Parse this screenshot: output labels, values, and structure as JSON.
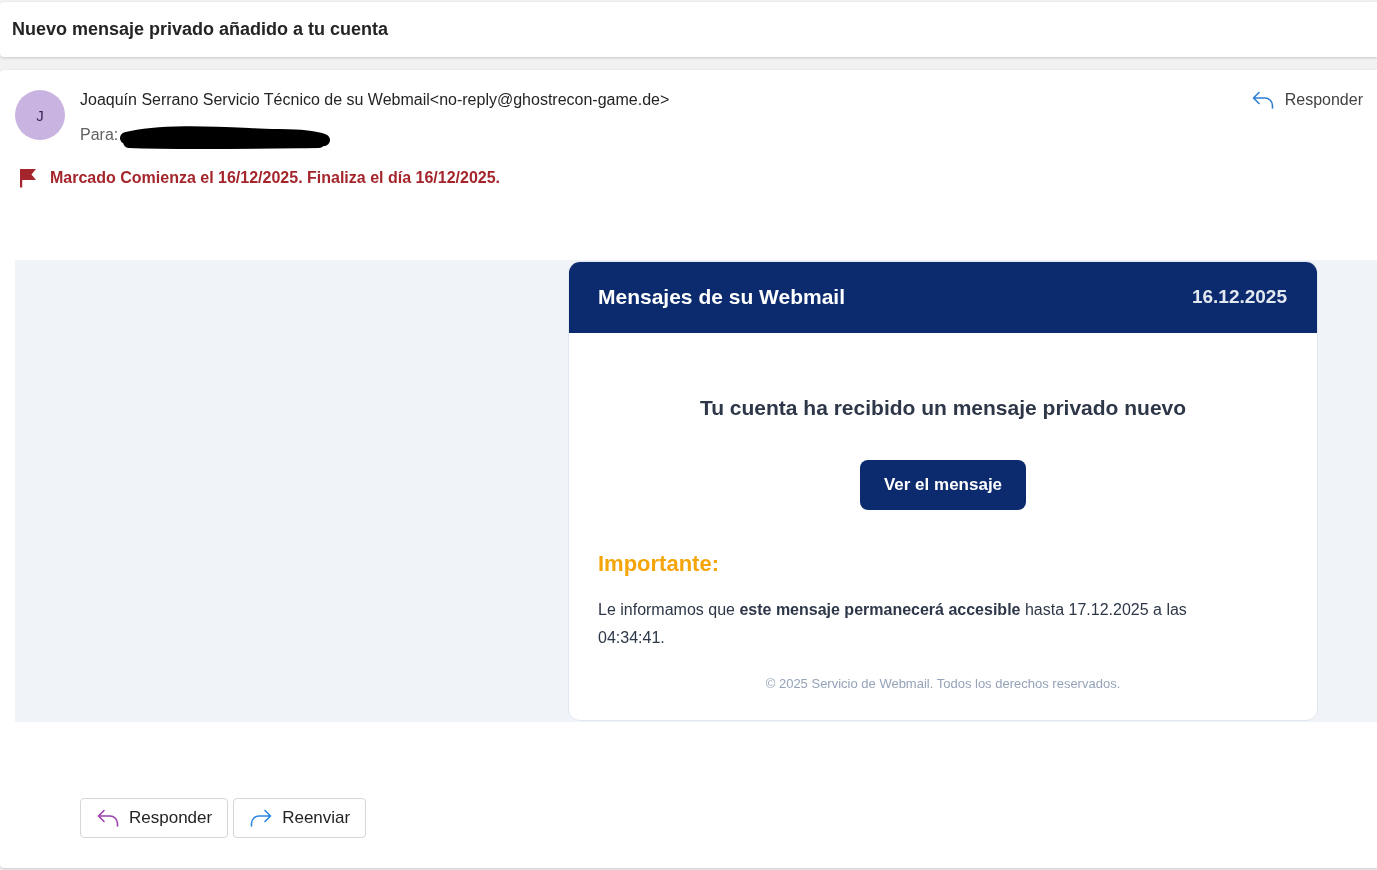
{
  "subject_bar": {
    "title": "Nuevo mensaje privado añadido a tu cuenta"
  },
  "message": {
    "avatar_initial": "J",
    "sender": "Joaquín Serrano Servicio Técnico de su Webmail<no-reply@ghostrecon-game.de>",
    "recipient_label": "Para:",
    "reply_link": "Responder",
    "flag_text": "Marcado Comienza el 16/12/2025. Finaliza el día 16/12/2025.",
    "email_body": {
      "banner_title": "Mensajes de su Webmail",
      "banner_date": "16.12.2025",
      "headline": "Tu cuenta ha recibido un mensaje privado nuevo",
      "cta_button": "Ver el mensaje",
      "notice_title": "Importante:",
      "notice_text": "Le informamos que **este mensaje permanecerá accesible** hasta 17.12.2025 a las 04:34:41.",
      "footer": "© 2025 Servicio de Webmail. Todos los derechos reservados."
    },
    "actions": [
      {
        "kind": "reply",
        "label": "Responder"
      },
      {
        "kind": "forward",
        "label": "Reenviar"
      }
    ]
  }
}
